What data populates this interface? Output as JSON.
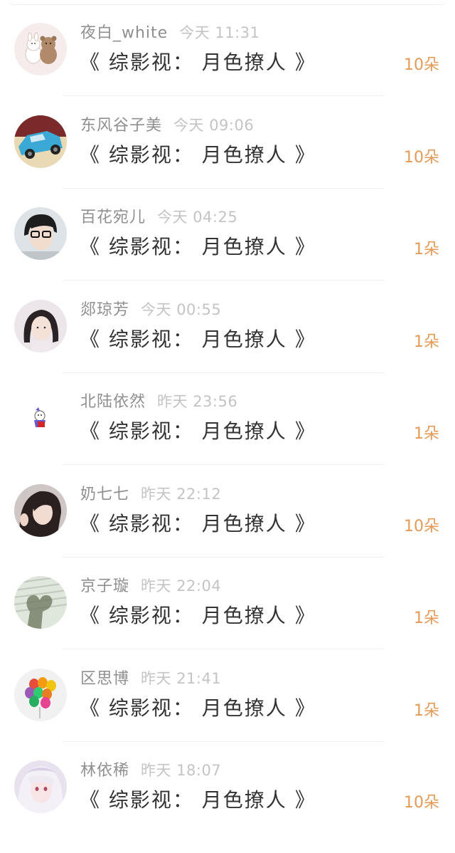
{
  "items": [
    {
      "name": "夜白_white",
      "time": "今天 11:31",
      "title": "《 综影视： 月色撩人 》",
      "gift": "10朵",
      "avatar": "avatar-bears"
    },
    {
      "name": "东风谷子美",
      "time": "今天 09:06",
      "title": "《 综影视： 月色撩人 》",
      "gift": "10朵",
      "avatar": "avatar-blue-car"
    },
    {
      "name": "百花宛儿",
      "time": "今天 04:25",
      "title": "《 综影视： 月色撩人 》",
      "gift": "1朵",
      "avatar": "avatar-glasses-boy"
    },
    {
      "name": "郯琼芳",
      "time": "今天 00:55",
      "title": "《 综影视： 月色撩人 》",
      "gift": "1朵",
      "avatar": "avatar-girl"
    },
    {
      "name": "北陆依然",
      "time": "昨天 23:56",
      "title": "《 综影视： 月色撩人 》",
      "gift": "1朵",
      "avatar": "avatar-cartoon"
    },
    {
      "name": "奶七七",
      "time": "昨天 22:12",
      "title": "《 综影视： 月色撩人 》",
      "gift": "10朵",
      "avatar": "avatar-woman"
    },
    {
      "name": "京子璇",
      "time": "昨天 22:04",
      "title": "《 综影视： 月色撩人 》",
      "gift": "1朵",
      "avatar": "avatar-tree"
    },
    {
      "name": "区思博",
      "time": "昨天 21:41",
      "title": "《 综影视： 月色撩人 》",
      "gift": "1朵",
      "avatar": "avatar-balloons"
    },
    {
      "name": "林依稀",
      "time": "昨天 18:07",
      "title": "《 综影视： 月色撩人 》",
      "gift": "10朵",
      "avatar": "avatar-anime-girl"
    }
  ],
  "colors": {
    "name": "#8f8f8f",
    "time": "#c4c4c4",
    "title": "#333333",
    "gift": "#e59a55",
    "divider": "#f0f0f0"
  }
}
